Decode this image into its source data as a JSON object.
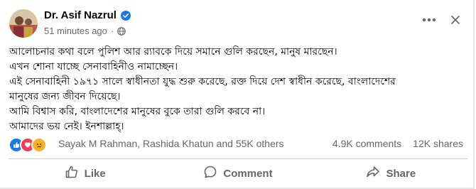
{
  "post": {
    "author": "Dr. Asif Nazrul",
    "time": "51 minutes ago",
    "lines": [
      "আলোচনার কথা বলে পুলিশ আর র‍্যাবকে দিয়ে সমানে গুলি করছেন, মানুষ মারছেন।",
      "এখন শোনা যাচ্ছে সেনাবাহিনীও নামাচ্ছেন।",
      "এই সেনাবাহিনী ১৯৭১ সালে স্বাধীনতা যুদ্ধ শুরু করেছে, রক্ত দিয়ে দেশ স্বাধীন করেছে, বাংলাদেশের",
      "মানুষের জন্য জীবন দিয়েছে।",
      "আমি বিশ্বাস করি, বাংলাদেশের মানুষের বুকে তারা গুলি করবে না।",
      "আমাদের ভয় নেই। ইনশাল্লাহ্।"
    ]
  },
  "reactions": {
    "icons": [
      "like-icon",
      "love-icon",
      "sad-icon"
    ],
    "names": "Sayak M Rahman, Rashida Khatun and 55K others",
    "comments": "4.9K comments",
    "shares": "12K shares"
  },
  "actions": {
    "like": "Like",
    "comment": "Comment",
    "share": "Share"
  },
  "colors": {
    "brand_blue": "#1877f2",
    "love_red": "#f33e58",
    "sad_yellow": "#f7b125",
    "muted": "#65676b"
  }
}
